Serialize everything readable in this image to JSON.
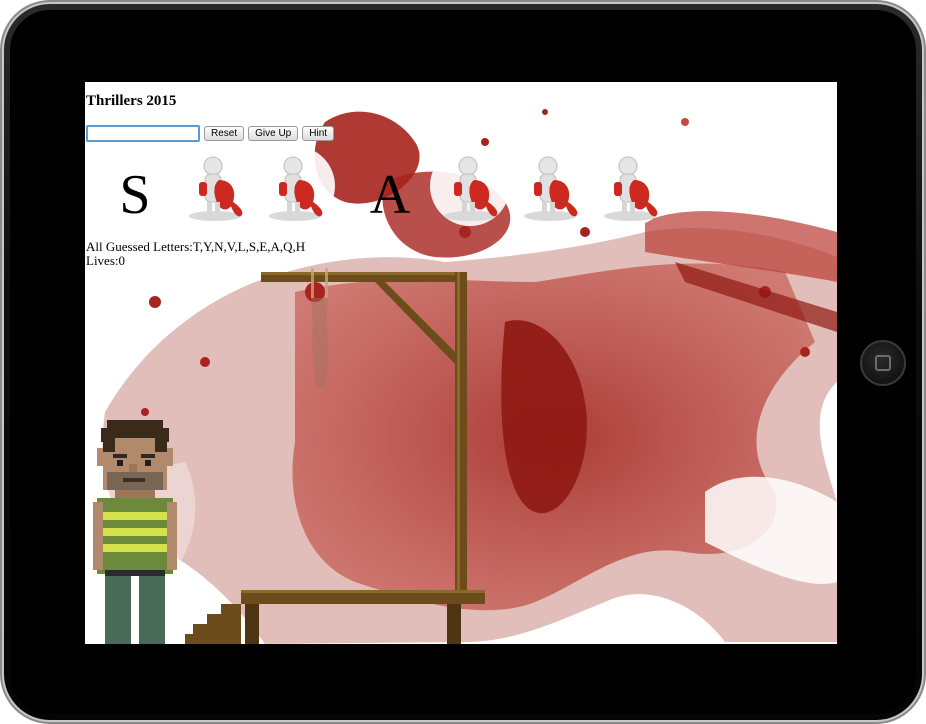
{
  "game": {
    "title": "Thrillers 2015",
    "input_value": "",
    "buttons": {
      "reset": "Reset",
      "give_up": "Give Up",
      "hint": "Hint"
    },
    "slots": [
      {
        "kind": "letter",
        "value": "S"
      },
      {
        "kind": "hidden",
        "icon": "hidden-letter-figure-icon"
      },
      {
        "kind": "hidden",
        "icon": "hidden-letter-figure-icon"
      },
      {
        "kind": "blank",
        "value": ""
      },
      {
        "kind": "letter",
        "value": "A"
      },
      {
        "kind": "hidden",
        "icon": "hidden-letter-figure-icon"
      },
      {
        "kind": "hidden",
        "icon": "hidden-letter-figure-icon"
      },
      {
        "kind": "hidden",
        "icon": "hidden-letter-figure-icon"
      }
    ],
    "guessed_label": "All Guessed Letters:",
    "guessed_letters": "T,Y,N,V,L,S,E,A,Q,H",
    "lives_label": "Lives:",
    "lives": "0"
  },
  "colors": {
    "blood": "#a8231e",
    "wood": "#6b4c1a",
    "tablet": "#0a0a0a"
  }
}
